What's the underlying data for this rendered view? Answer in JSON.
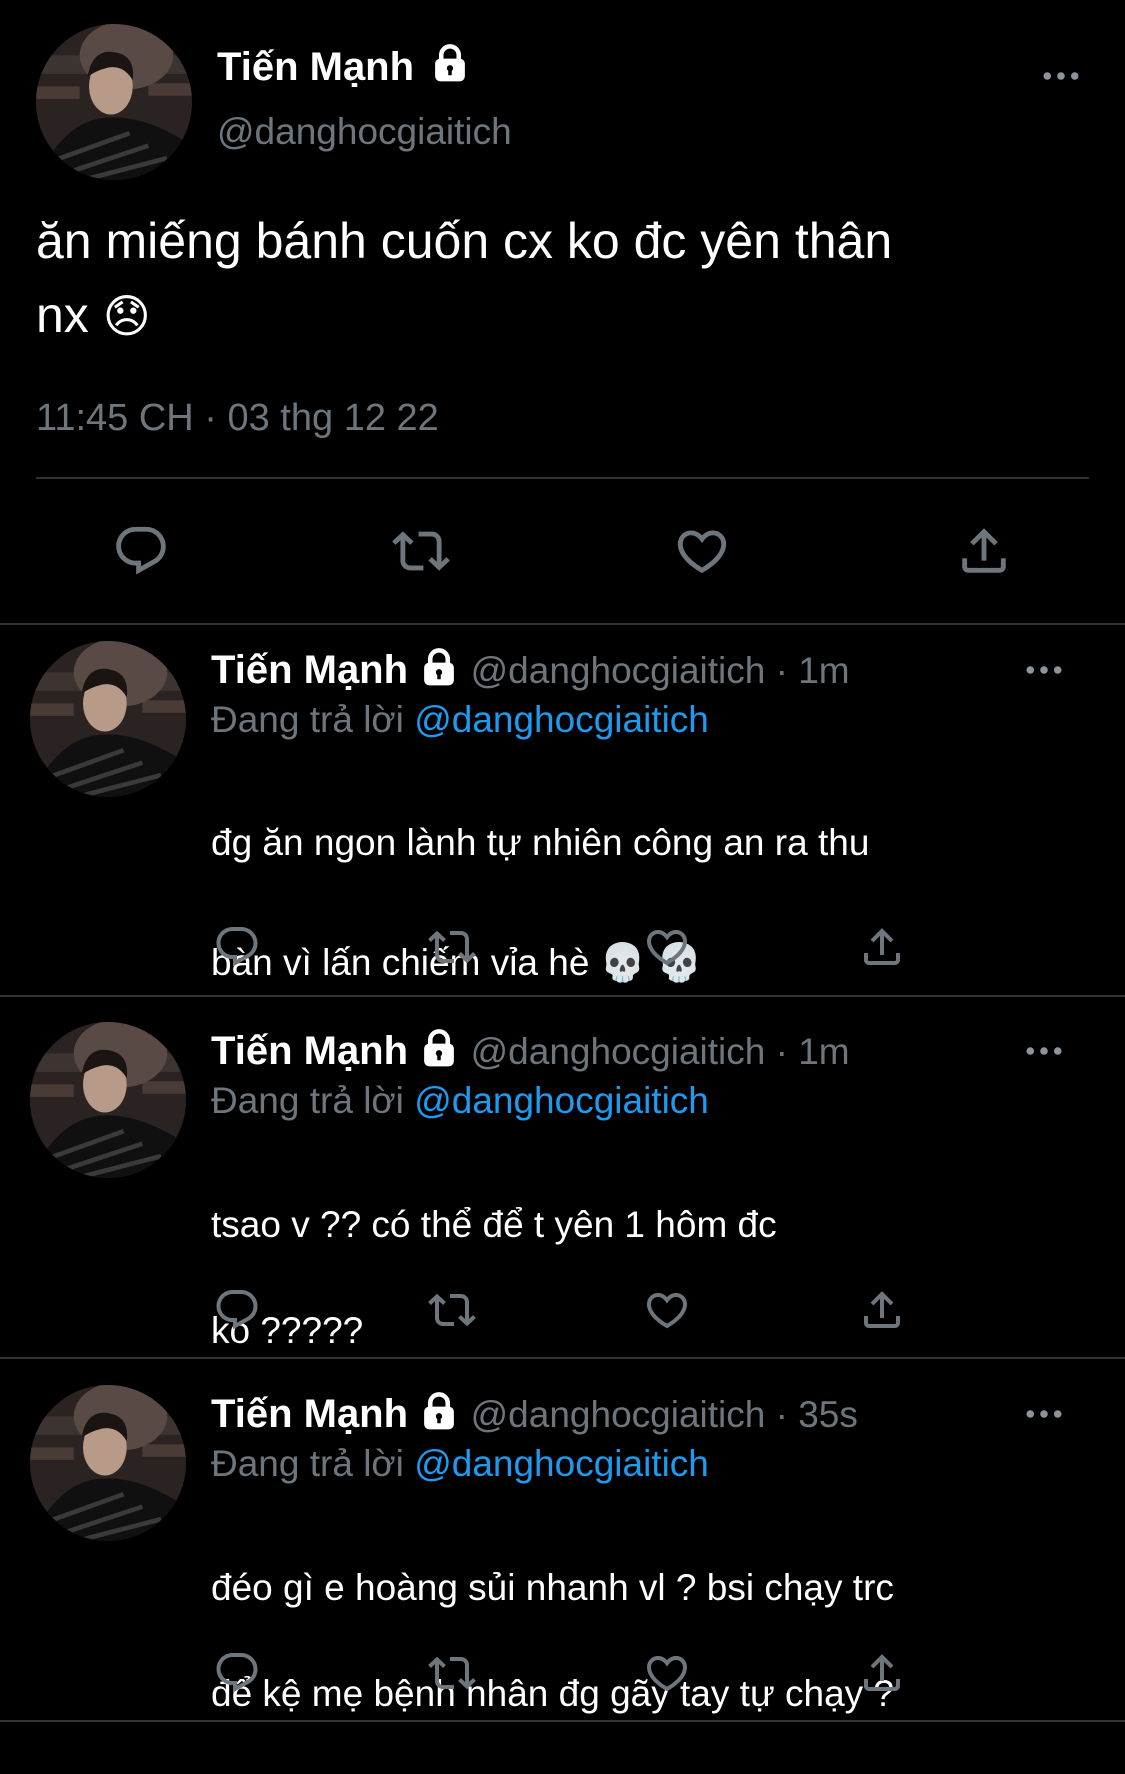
{
  "main_tweet": {
    "name": "Tiến Mạnh",
    "handle": "@danghocgiaitich",
    "text_line1": "ăn miếng bánh cuốn cx ko đc yên thân",
    "text_line2": "nx",
    "emoji": "😞",
    "timestamp": "11:45 CH · 03 thg 12 22"
  },
  "replies": [
    {
      "name": "Tiến Mạnh",
      "handle": "@danghocgiaitich",
      "time": "· 1m",
      "replying_prefix": "Đang trả lời",
      "replying_to": "@danghocgiaitich",
      "text_line1": "đg ăn ngon lành tự nhiên công an ra thu",
      "text_line2": "bàn vì lấn chiếm vỉa hè 💀 💀"
    },
    {
      "name": "Tiến Mạnh",
      "handle": "@danghocgiaitich",
      "time": "· 1m",
      "replying_prefix": "Đang trả lời",
      "replying_to": "@danghocgiaitich",
      "text_line1": "tsao v ?? có thể để t yên 1 hôm đc",
      "text_line2": "ko ?????"
    },
    {
      "name": "Tiến Mạnh",
      "handle": "@danghocgiaitich",
      "time": "· 35s",
      "replying_prefix": "Đang trả lời",
      "replying_to": "@danghocgiaitich",
      "text_line1": "đéo gì e hoàng sủi nhanh vl ? bsi chạy trc",
      "text_line2": "để kệ mẹ bệnh nhân đg gãy tay tự chạy ?"
    }
  ],
  "colors": {
    "background": "#000000",
    "muted": "#6e767d",
    "link": "#1d9bf0",
    "divider": "#2f3336"
  },
  "icons": [
    "lock-icon",
    "more-icon",
    "reply-icon",
    "retweet-icon",
    "like-icon",
    "share-icon"
  ]
}
